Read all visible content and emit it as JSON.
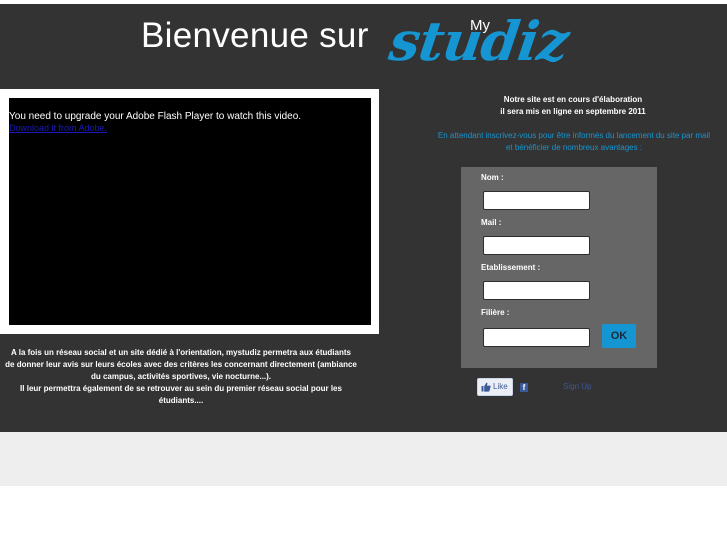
{
  "header": {
    "welcome_text": "Bienvenue sur",
    "logo_small": "My",
    "logo_word": "studiz",
    "logo_color": "#1596d3"
  },
  "video": {
    "flash_message": "You need to upgrade your Adobe Flash Player to watch this video.",
    "flash_link": "Download it from Adobe."
  },
  "description": {
    "lines": [
      "A la fois un réseau social et un site dédié à l'orientation, mystudiz permetra aux étudiants",
      "de donner leur avis sur leurs écoles avec des critères les concernant directement (ambiance",
      "du campus, activités sportives, vie nocturne...).",
      "Il leur permettra également de se retrouver au sein du premier réseau social pour les",
      "étudiants...."
    ]
  },
  "notice": {
    "line1": "Notre site est en cours d'élaboration",
    "line2": "il sera mis en ligne en septembre 2011"
  },
  "invite": {
    "line1": "En attendant inscrivez-vous pour être informés du lancement du site par mail",
    "line2": "et bénéficier de nombreux avantages :"
  },
  "form": {
    "fields": [
      {
        "label": "Nom :",
        "value": "",
        "placeholder": ""
      },
      {
        "label": "Mail :",
        "value": "",
        "placeholder": ""
      },
      {
        "label": "Etablissement :",
        "value": "",
        "placeholder": ""
      },
      {
        "label": "Filière :",
        "value": "",
        "placeholder": ""
      }
    ],
    "submit_label": "OK"
  },
  "social": {
    "like_label": "Like",
    "facebook_icon": "facebook-icon",
    "signup_label": "Sign Up"
  },
  "colors": {
    "main_bg": "#333333",
    "form_bg": "#666666",
    "accent": "#1596d3",
    "footer_bg": "#eeeeee"
  }
}
